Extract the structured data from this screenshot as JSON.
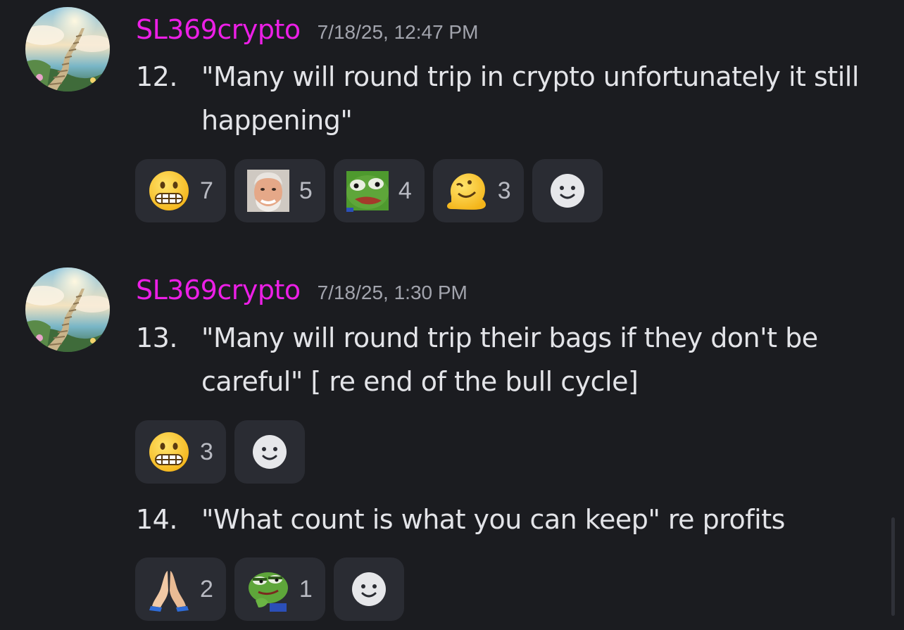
{
  "messages": [
    {
      "username": "SL369crypto",
      "timestamp": "7/18/25, 12:47 PM",
      "avatar_icon": "stairway-to-heaven-avatar",
      "items": [
        {
          "number": "12.",
          "text": "\"Many will round trip in crypto unfortunately it still happening\"",
          "reactions": [
            {
              "emoji": "grimacing-face-emoji",
              "count": "7"
            },
            {
              "emoji": "hide-the-pain-harold-emoji",
              "count": "5"
            },
            {
              "emoji": "pepe-frog-emoji",
              "count": "4"
            },
            {
              "emoji": "melting-face-emoji",
              "count": "3"
            }
          ]
        }
      ]
    },
    {
      "username": "SL369crypto",
      "timestamp": "7/18/25, 1:30 PM",
      "avatar_icon": "stairway-to-heaven-avatar",
      "items": [
        {
          "number": "13.",
          "text": "\"Many will round trip their bags if they don't be careful\"  [ re end of the bull cycle]",
          "reactions": [
            {
              "emoji": "grimacing-face-emoji",
              "count": "3"
            }
          ]
        },
        {
          "number": "14.",
          "text": "\"What count is what you can keep\"  re profits",
          "reactions": [
            {
              "emoji": "folded-hands-emoji",
              "count": "2"
            },
            {
              "emoji": "smug-pepe-frog-emoji",
              "count": "1"
            }
          ]
        }
      ]
    }
  ],
  "colors": {
    "background": "#1b1c20",
    "username": "#ec1fe6",
    "timestamp": "#a2a4ad",
    "message_text": "#e3e4e8",
    "reaction_background": "#2a2c33",
    "reaction_count": "#b8bac2"
  },
  "add_reaction_icon": "add-reaction-smiley-icon"
}
